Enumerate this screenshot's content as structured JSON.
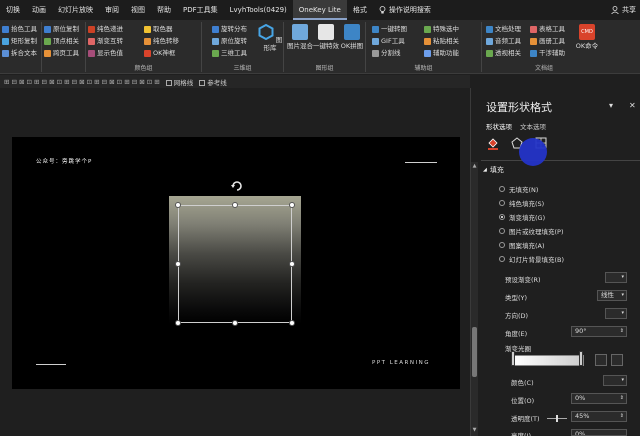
{
  "tabs": [
    "切换",
    "动画",
    "幻灯片放映",
    "审阅",
    "视图",
    "帮助",
    "PDF工具集",
    "LvyhTools(0429)",
    "OneKey Lite",
    "格式"
  ],
  "active_tab": "OneKey Lite",
  "search_tab": "操作说明搜索",
  "share": "共享",
  "ribbon": {
    "g1": [
      "拾色工具",
      "矩形复制",
      "拆合文本"
    ],
    "g2": [
      "原位复制",
      "顶点相关",
      "跨页工具"
    ],
    "g3": [
      "纯色递进",
      "渐变互转",
      "显示色值"
    ],
    "g4": [
      "取色器",
      "纯色转移",
      "OK神框"
    ],
    "g4_name": "颜色组",
    "g5": [
      "旋转分布",
      "原位旋转",
      "三维工具"
    ],
    "g5_big": "图形库",
    "g5_name": "三维组",
    "g6_big": [
      "图片混合",
      "一键特效",
      "OK拼图"
    ],
    "g6_name": "图形组",
    "g7": [
      "一键转图",
      "GIF工具",
      "分割线"
    ],
    "g8": [
      "特殊选中",
      "粘贴相关",
      "辅助功能"
    ],
    "g8_name": "辅助组",
    "g9": [
      "文档处理",
      "音频工具",
      "透视相关"
    ],
    "g10": [
      "表格工具",
      "画册工具",
      "干涉辅助"
    ],
    "g10_big": "OK命令",
    "g10_icon": "CMD",
    "g10_name": "文档组"
  },
  "quickbar": {
    "gridlines": "网格线",
    "guides": "参考线"
  },
  "slide": {
    "title": "公众号：旁跳学个P",
    "footer": "PPT LEARNING"
  },
  "panel": {
    "title": "设置形状格式",
    "tab1": "形状选项",
    "tab2": "文本选项",
    "section": "填充",
    "fill_options": [
      "无填充(N)",
      "纯色填充(S)",
      "渐变填充(G)",
      "图片或纹理填充(P)",
      "图案填充(A)",
      "幻灯片背景填充(B)"
    ],
    "selected_fill": "渐变填充(G)",
    "preset_label": "预设渐变(R)",
    "type_label": "类型(Y)",
    "type_value": "线性",
    "direction_label": "方向(D)",
    "angle_label": "角度(E)",
    "angle_value": "90°",
    "stops_label": "渐变光圈",
    "color_label": "颜色(C)",
    "position_label": "位置(O)",
    "position_value": "0%",
    "transparency_label": "透明度(T)",
    "transparency_value": "45%",
    "brightness_label": "亮度(I)",
    "brightness_value": "0%"
  },
  "colors": {
    "accent": "#2434c8",
    "shape_top": "#a6a692",
    "cmd_icon": "#d9432b"
  }
}
